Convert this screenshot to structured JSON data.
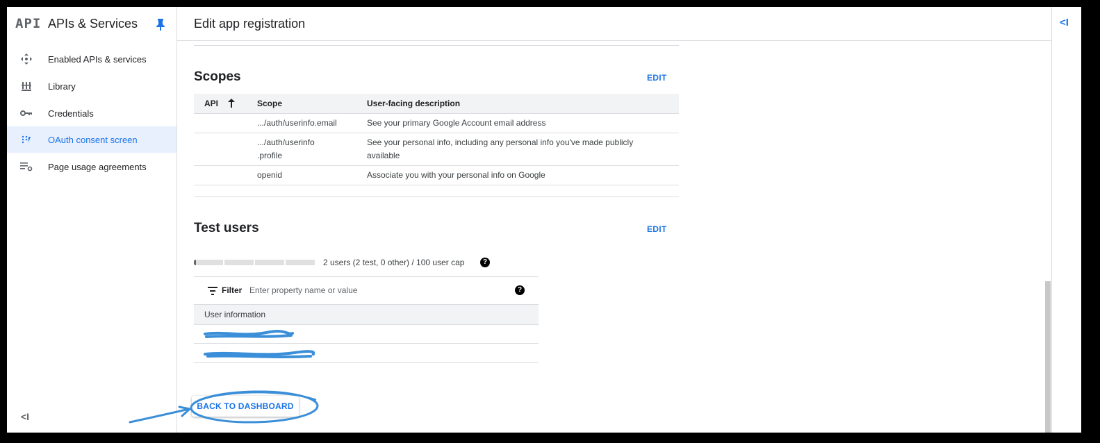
{
  "sidebar": {
    "logo": "API",
    "title": "APIs & Services",
    "items": [
      {
        "label": "Enabled APIs & services",
        "icon": "enabled-apis-icon"
      },
      {
        "label": "Library",
        "icon": "library-icon"
      },
      {
        "label": "Credentials",
        "icon": "key-icon"
      },
      {
        "label": "OAuth consent screen",
        "icon": "oauth-icon",
        "active": true
      },
      {
        "label": "Page usage agreements",
        "icon": "agreements-icon"
      }
    ],
    "collapse_label": "<I"
  },
  "header": {
    "title": "Edit app registration",
    "right_collapse_label": "<I"
  },
  "scopes": {
    "title": "Scopes",
    "edit_label": "EDIT",
    "columns": [
      "API",
      "Scope",
      "User-facing description"
    ],
    "rows": [
      {
        "api": "",
        "scope": ".../auth/userinfo.email",
        "description": "See your primary Google Account email address"
      },
      {
        "api": "",
        "scope": ".../auth/userinfo\n.profile",
        "description": "See your personal info, including any personal info you've made publicly available"
      },
      {
        "api": "",
        "scope": "openid",
        "description": "Associate you with your personal info on Google"
      }
    ]
  },
  "test_users": {
    "title": "Test users",
    "edit_label": "EDIT",
    "cap_text": "2 users (2 test, 0 other) / 100 user cap",
    "cap_used": 2,
    "cap_total": 100,
    "filter_label": "Filter",
    "filter_placeholder": "Enter property name or value",
    "column": "User information",
    "users": [
      "",
      ""
    ]
  },
  "actions": {
    "back_label": "BACK TO DASHBOARD"
  },
  "colors": {
    "accent": "#1a73e8",
    "active_bg": "#e8f0fe",
    "annotation": "#3b8fd8"
  }
}
